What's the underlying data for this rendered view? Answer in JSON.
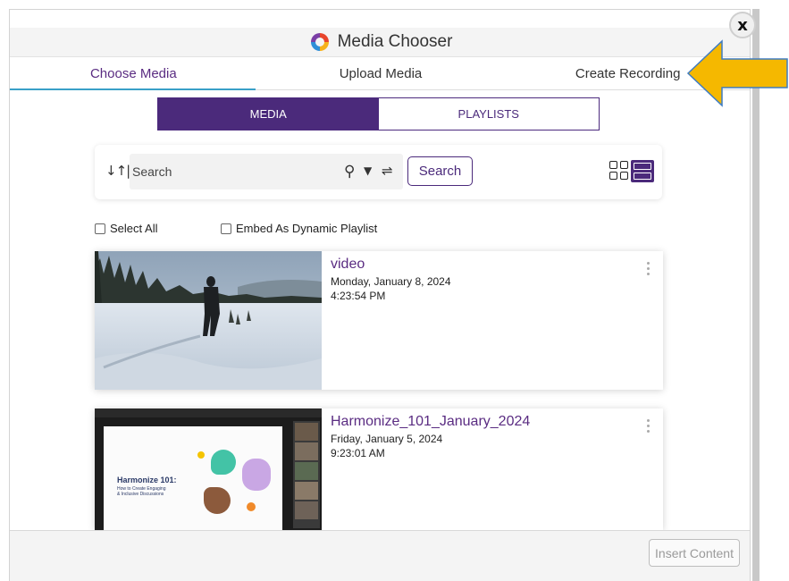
{
  "window": {
    "title": "Media Chooser",
    "close_label": "x"
  },
  "tabs": [
    {
      "label": "Choose Media",
      "active": true
    },
    {
      "label": "Upload Media",
      "active": false
    },
    {
      "label": "Create Recording",
      "active": false
    }
  ],
  "segmented": {
    "media_label": "MEDIA",
    "playlists_label": "PLAYLISTS",
    "selected": "MEDIA"
  },
  "search": {
    "placeholder": "Search",
    "value": "",
    "button_label": "Search"
  },
  "icons": {
    "sort": "sort-icon",
    "magnifier": "search-icon",
    "dropdown": "chevron-down-icon",
    "filter": "filter-sliders-icon",
    "grid_view": "grid-view-icon",
    "list_view": "list-view-icon",
    "more": "kebab-menu-icon",
    "annotation": "arrow-pointer-icon"
  },
  "options": {
    "select_all": "Select All",
    "embed_dynamic": "Embed As Dynamic Playlist"
  },
  "media_items": [
    {
      "name": "video",
      "date": "Monday, January 8, 2024",
      "time": "4:23:54 PM",
      "thumbnail": "snowy-forest-walker"
    },
    {
      "name": "Harmonize_101_January_2024",
      "date": "Friday, January 5, 2024",
      "time": "9:23:01 AM",
      "thumbnail": "presentation-slide",
      "slide_title": "Harmonize 101:",
      "slide_subtitle_line1": "How to Create Engaging",
      "slide_subtitle_line2": "& Inclusive Discussions"
    }
  ],
  "footer": {
    "insert_label": "Insert Content",
    "insert_enabled": false
  },
  "colors": {
    "brand_purple": "#4b2a7b",
    "title_purple": "#5a2c82",
    "active_tab_underline": "#3aa0c8",
    "annotation_arrow": "#f5b800"
  }
}
